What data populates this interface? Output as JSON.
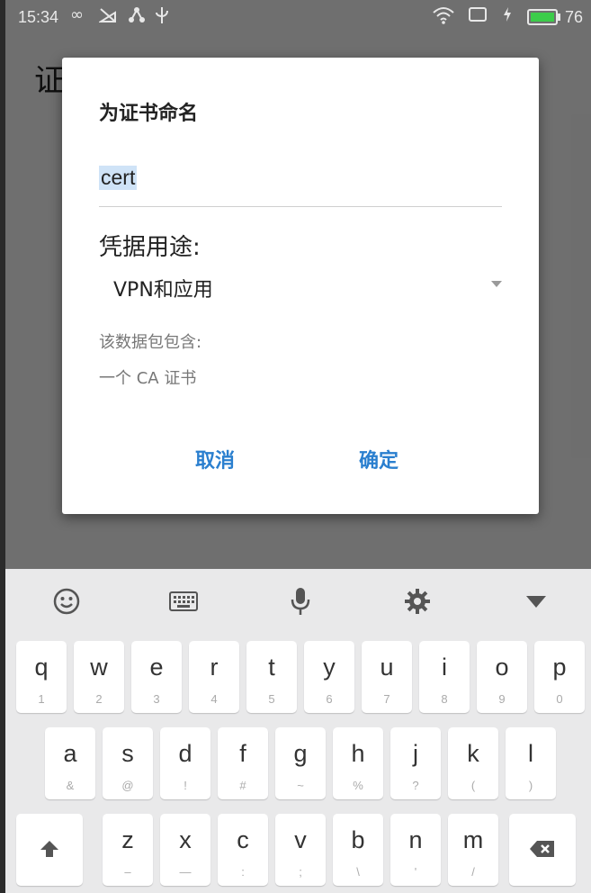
{
  "status_bar": {
    "time": "15:34",
    "battery_level": "76",
    "battery_color": "#3ccc4a"
  },
  "background_screen": {
    "title": "证"
  },
  "dialog": {
    "title": "为证书命名",
    "name_value": "cert",
    "usage_label": "凭据用途:",
    "usage_value": "VPN和应用",
    "contains_label": "该数据包包含:",
    "contains_item": "一个 CA 证书",
    "cancel_label": "取消",
    "ok_label": "确定",
    "accent_color": "#2a7fcf"
  },
  "keyboard": {
    "toolbar_icons": [
      "smiley-icon",
      "keyboard-icon",
      "microphone-icon",
      "gear-icon",
      "chevron-down-icon"
    ],
    "row1": [
      {
        "k": "q",
        "s": "1"
      },
      {
        "k": "w",
        "s": "2"
      },
      {
        "k": "e",
        "s": "3"
      },
      {
        "k": "r",
        "s": "4"
      },
      {
        "k": "t",
        "s": "5"
      },
      {
        "k": "y",
        "s": "6"
      },
      {
        "k": "u",
        "s": "7"
      },
      {
        "k": "i",
        "s": "8"
      },
      {
        "k": "o",
        "s": "9"
      },
      {
        "k": "p",
        "s": "0"
      }
    ],
    "row2": [
      {
        "k": "a",
        "s": "&"
      },
      {
        "k": "s",
        "s": "@"
      },
      {
        "k": "d",
        "s": "!"
      },
      {
        "k": "f",
        "s": "#"
      },
      {
        "k": "g",
        "s": "~"
      },
      {
        "k": "h",
        "s": "%"
      },
      {
        "k": "j",
        "s": "?"
      },
      {
        "k": "k",
        "s": "("
      },
      {
        "k": "l",
        "s": ")"
      }
    ],
    "row3": [
      {
        "k": "z",
        "s": "–"
      },
      {
        "k": "x",
        "s": "—"
      },
      {
        "k": "c",
        "s": ":"
      },
      {
        "k": "v",
        "s": ";"
      },
      {
        "k": "b",
        "s": "\\"
      },
      {
        "k": "n",
        "s": "'"
      },
      {
        "k": "m",
        "s": "/"
      }
    ]
  }
}
